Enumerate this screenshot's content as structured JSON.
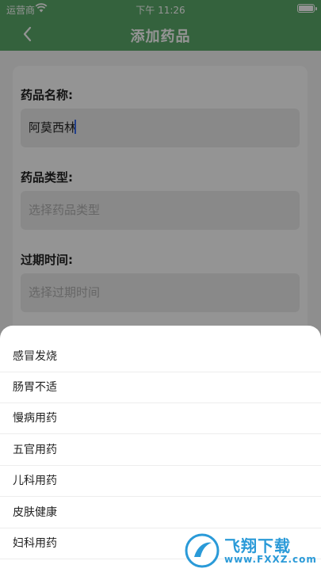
{
  "status_bar": {
    "carrier": "运营商",
    "time": "下午 11:26",
    "wifi_icon": "wifi-icon",
    "battery_icon": "battery-icon"
  },
  "nav": {
    "title": "添加药品",
    "back_icon": "chevron-left-icon"
  },
  "form": {
    "name_label": "药品名称:",
    "name_value": "阿莫西林",
    "type_label": "药品类型:",
    "type_placeholder": "选择药品类型",
    "expiry_label": "过期时间:",
    "expiry_placeholder": "选择过期时间"
  },
  "picker": {
    "options": [
      "感冒发烧",
      "肠胃不适",
      "慢病用药",
      "五官用药",
      "儿科用药",
      "皮肤健康",
      "妇科用药"
    ]
  },
  "watermark": {
    "name": "飞翔下载",
    "url": "www.FXXZ.com"
  },
  "colors": {
    "header_green": "#5aa969",
    "watermark_blue": "#2a9ad8"
  }
}
